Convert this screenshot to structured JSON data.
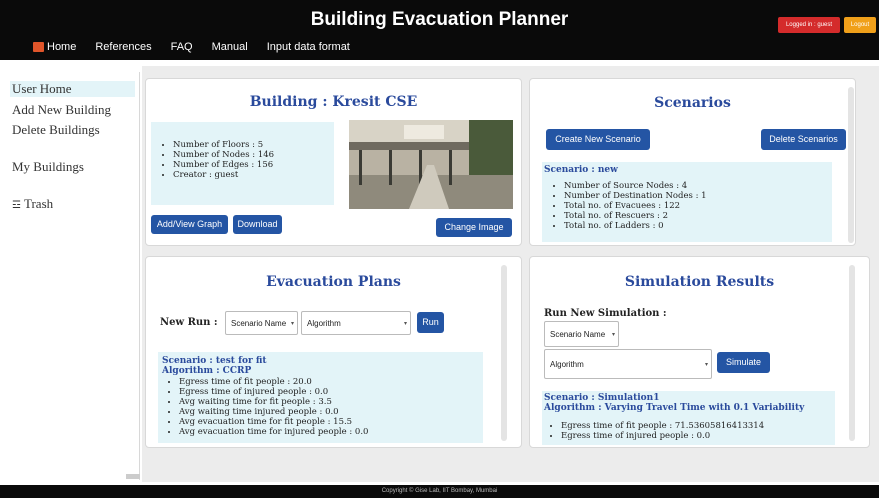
{
  "app": {
    "title": "Building Evacuation Planner",
    "login_status": "Logged in : guest",
    "logout_label": "Logout"
  },
  "nav": {
    "items": [
      "Home",
      "References",
      "FAQ",
      "Manual",
      "Input data format"
    ]
  },
  "sidebar": {
    "items": [
      "User Home",
      "Add New Building",
      "Delete Buildings",
      "My Buildings",
      "Trash"
    ]
  },
  "building": {
    "title": "Building : Kresit CSE",
    "stats": [
      "Number of Floors : 5",
      "Number of Nodes : 146",
      "Number of Edges : 156",
      "Creator : guest"
    ],
    "add_view_label": "Add/View Graph",
    "download_label": "Download",
    "change_image_label": "Change Image"
  },
  "scenarios": {
    "title": "Scenarios",
    "create_label": "Create New Scenario",
    "delete_label": "Delete Scenarios",
    "scenario_name": "Scenario : new",
    "stats": [
      "Number of Source Nodes : 4",
      "Number of Destination Nodes : 1",
      "Total no. of Evacuees : 122",
      "Total no. of Rescuers : 2",
      "Total no. of Ladders : 0"
    ]
  },
  "evacuation": {
    "title": "Evacuation Plans",
    "new_run_label": "New Run :",
    "scenario_select": "Scenario Name",
    "algorithm_select": "Algorithm",
    "run_label": "Run",
    "scenario_line": "Scenario : test for fit",
    "algorithm_line": "Algorithm : CCRP",
    "results": [
      "Egress time of fit people : 20.0",
      "Egress time of injured people : 0.0",
      "Avg waiting time for fit people : 3.5",
      "Avg waiting time injured people : 0.0",
      "Avg evacuation time for fit people : 15.5",
      "Avg evacuation time for injured people : 0.0"
    ]
  },
  "simulation": {
    "title": "Simulation Results",
    "run_label": "Run New Simulation :",
    "scenario_select": "Scenario Name",
    "algorithm_select": "Algorithm",
    "simulate_label": "Simulate",
    "scenario_line": "Scenario : Simulation1",
    "algorithm_line": "Algorithm : Varying Travel Time with 0.1 Variability",
    "results": [
      "Egress time of fit people : 71.53605816413314",
      "Egress time of injured people : 0.0"
    ]
  },
  "footer": {
    "text": "Copyright © Gise Lab, IIT Bombay, Mumbai"
  },
  "colors": {
    "accent": "#2455a4",
    "title_blue": "#2a4a9c",
    "info_bg": "#e3f4f8",
    "login_red": "#d42b2b",
    "logout_orange": "#f0a01a"
  }
}
